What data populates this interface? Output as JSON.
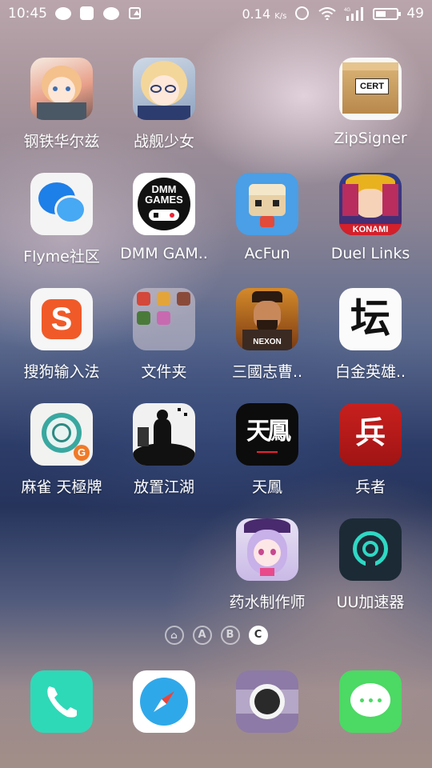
{
  "status_bar": {
    "time": "10:45",
    "net_speed": "0.14",
    "net_unit": "K/s",
    "network_type": "4G",
    "battery": "49",
    "battery_level_pct": 49
  },
  "apps": [
    {
      "label": "钢铁华尔兹",
      "icon": "anime-girl-icon"
    },
    {
      "label": "战舰少女",
      "icon": "anime-girl-glasses-icon"
    },
    {
      "label": "ZipSigner",
      "icon": "cert-box-icon",
      "icon_text": "CERT"
    },
    {
      "label": "Flyme社区",
      "icon": "chat-bubbles-icon"
    },
    {
      "label": "DMM GAM..",
      "icon": "dmm-games-icon",
      "icon_text": "DMM GAMES"
    },
    {
      "label": "AcFun",
      "icon": "acfun-icon"
    },
    {
      "label": "Duel Links",
      "icon": "duel-links-icon",
      "icon_text": "KONAMI"
    },
    {
      "label": "搜狗输入法",
      "icon": "sogou-s-icon",
      "icon_text": "S"
    },
    {
      "label": "文件夹",
      "icon": "folder-icon"
    },
    {
      "label": "三國志曹..",
      "icon": "three-kingdoms-icon",
      "icon_text": "NEXON"
    },
    {
      "label": "白金英雄..",
      "icon": "calligraphy-icon",
      "icon_text": "坛"
    },
    {
      "label": "麻雀 天極牌",
      "icon": "mahjong-tile-icon",
      "icon_text": "G"
    },
    {
      "label": "放置江湖",
      "icon": "wuxia-silhouette-icon"
    },
    {
      "label": "天鳳",
      "icon": "tenhou-icon",
      "icon_text": "天鳳"
    },
    {
      "label": "兵者",
      "icon": "bingzhe-icon",
      "icon_text": "兵"
    },
    {
      "label": "药水制作师",
      "icon": "potion-witch-icon"
    },
    {
      "label": "UU加速器",
      "icon": "uu-accelerator-icon"
    }
  ],
  "page_indicator": {
    "pages": [
      "home",
      "A",
      "B",
      "C"
    ],
    "active": "C"
  },
  "dock": [
    {
      "name": "phone",
      "icon": "phone-icon"
    },
    {
      "name": "browser",
      "icon": "compass-icon"
    },
    {
      "name": "camera",
      "icon": "camera-icon"
    },
    {
      "name": "messages",
      "icon": "message-icon"
    }
  ],
  "colors": {
    "phone": "#2ed9b8",
    "compass": "#2fa8ea",
    "camera": "#8d7aa6",
    "messages": "#4cd964",
    "acfun": "#4a9fe6",
    "sogou": "#f05a28"
  }
}
